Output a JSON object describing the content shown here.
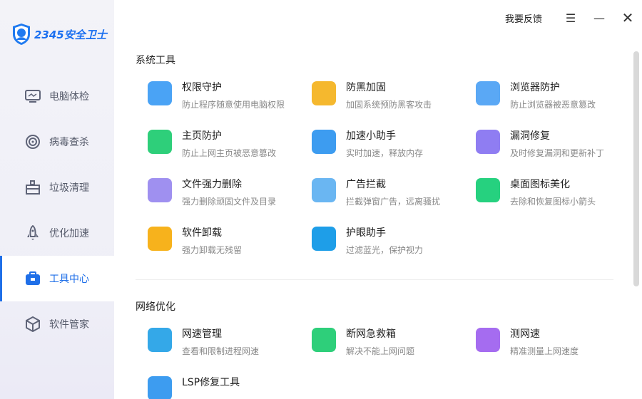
{
  "app": {
    "logo_text": "2345安全卫士"
  },
  "header": {
    "feedback": "我要反馈"
  },
  "sidebar": {
    "items": [
      {
        "label": "电脑体检",
        "icon": "monitor-icon"
      },
      {
        "label": "病毒查杀",
        "icon": "target-icon"
      },
      {
        "label": "垃圾清理",
        "icon": "broom-icon"
      },
      {
        "label": "优化加速",
        "icon": "rocket-icon"
      },
      {
        "label": "工具中心",
        "icon": "toolbox-icon",
        "active": true
      },
      {
        "label": "软件管家",
        "icon": "cube-icon"
      }
    ]
  },
  "sections": [
    {
      "title": "系统工具",
      "tools": [
        {
          "name": "权限守护",
          "desc": "防止程序随意使用电脑权限",
          "color": "#4aa3f5"
        },
        {
          "name": "防黑加固",
          "desc": "加固系统预防黑客攻击",
          "color": "#f5b82e"
        },
        {
          "name": "浏览器防护",
          "desc": "防止浏览器被恶意篡改",
          "color": "#5aa8f5"
        },
        {
          "name": "主页防护",
          "desc": "防止上网主页被恶意篡改",
          "color": "#2ecf7a"
        },
        {
          "name": "加速小助手",
          "desc": "实时加速，释放内存",
          "color": "#3d9cf0"
        },
        {
          "name": "漏洞修复",
          "desc": "及时修复漏洞和更新补丁",
          "color": "#8f7df2"
        },
        {
          "name": "文件强力删除",
          "desc": "强力删除顽固文件及目录",
          "color": "#9f90f0"
        },
        {
          "name": "广告拦截",
          "desc": "拦截弹窗广告，远离骚扰",
          "color": "#6ab6f2"
        },
        {
          "name": "桌面图标美化",
          "desc": "去除和恢复图标小箭头",
          "color": "#26d17f"
        },
        {
          "name": "软件卸载",
          "desc": "强力卸载无残留",
          "color": "#f7b21c"
        },
        {
          "name": "护眼助手",
          "desc": "过滤蓝光，保护视力",
          "color": "#1e9ee8"
        }
      ]
    },
    {
      "title": "网络优化",
      "tools": [
        {
          "name": "网速管理",
          "desc": "查看和限制进程网速",
          "color": "#34a8e8"
        },
        {
          "name": "断网急救箱",
          "desc": "解决不能上网问题",
          "color": "#2ecf7a"
        },
        {
          "name": "测网速",
          "desc": "精准测量上网速度",
          "color": "#a56cf0"
        },
        {
          "name": "LSP修复工具",
          "desc": "",
          "color": "#3d9cf0"
        }
      ]
    }
  ]
}
